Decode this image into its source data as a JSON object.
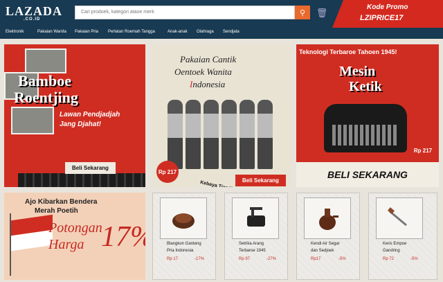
{
  "header": {
    "logo_main": "LAZADA",
    "logo_sub": ".CO.ID",
    "search_placeholder": "Cari prodoek, kategori ataoe merk",
    "promo_label": "Kode Promo",
    "promo_code": "LZIPRICE17"
  },
  "nav": {
    "items": [
      {
        "label": "Elektronik"
      },
      {
        "label": "Pakaian Wanita"
      },
      {
        "label": "Pakaian Pria"
      },
      {
        "label": "Perlatan Roemah Tangga"
      },
      {
        "label": "Anak-anak"
      },
      {
        "label": "Olahraga"
      },
      {
        "label": "Sendjata"
      }
    ]
  },
  "banners": {
    "left": {
      "title_line1": "Bamboe",
      "title_line2": "Roentjing",
      "sub_line1": "Lawan Pendjadjah",
      "sub_line2": "Jang Djahat!",
      "cta": "Beli Sekarang"
    },
    "middle": {
      "title_line1": "Pakaian Cantik",
      "title_line2": "Oentoek Wanita",
      "title_line3_prefix": "I",
      "title_line3_rest": "ndonesia",
      "caption": "Kebaya Tjantik Indonesia",
      "price": "Rp 217",
      "cta": "Beli Sekarang"
    },
    "right": {
      "heading": "Teknologi Terbaroe Tahoen 1945!",
      "title_line1": "Mesin",
      "title_line2": "Ketik",
      "price": "Rp 217",
      "cta": "BELI SEKARANG"
    },
    "flag": {
      "heading_line1": "Ajo Kibarkan Bendera",
      "heading_line2": "Merah Poetih",
      "promo_line1": "Potongan",
      "promo_line2": "Harga",
      "percent": "17%"
    }
  },
  "products": [
    {
      "name_line1": "Blangkon Ganteng",
      "name_line2": "Pria Indonesia",
      "price": "Rp 17",
      "discount": "-17%",
      "icon": "blangkon-hat-icon"
    },
    {
      "name_line1": "Setrika Arang",
      "name_line2": "Terbaroe 1945",
      "price": "Rp 97",
      "discount": "-27%",
      "icon": "iron-icon"
    },
    {
      "name_line1": "Kendi Air Segar",
      "name_line2": "dan Sedjoek",
      "price": "Rp17",
      "discount": "-5%",
      "icon": "water-jug-icon"
    },
    {
      "name_line1": "Keris Empoe",
      "name_line2": "Gandring",
      "price": "Rp 72",
      "discount": "-5%",
      "icon": "keris-dagger-icon"
    }
  ],
  "colors": {
    "navbar": "#183a52",
    "accent_red": "#d02d22",
    "search_button": "#e96a2c"
  }
}
